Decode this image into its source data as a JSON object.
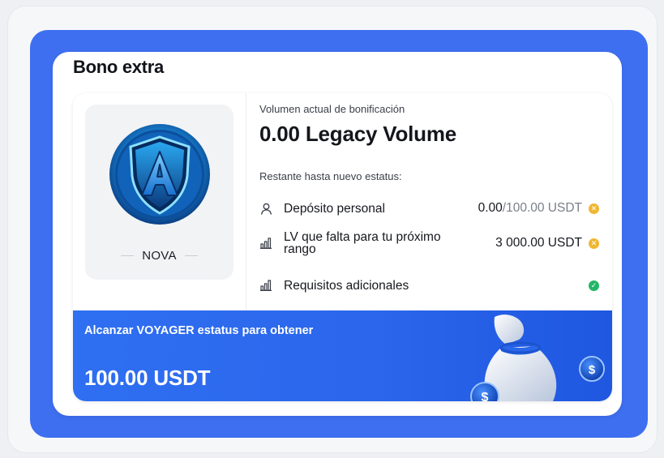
{
  "panel": {
    "title": "Bono extra"
  },
  "badge": {
    "rank_name": "NOVA",
    "icon": "shield-a-icon"
  },
  "volume": {
    "label": "Volumen actual de bonificación",
    "value": "0.00 Legacy Volume"
  },
  "remaining": {
    "label": "Restante hasta nuevo estatus:"
  },
  "requirements": [
    {
      "icon": "user-icon",
      "label": "Depósito personal",
      "current": "0.00",
      "separator": " / ",
      "target": "100.00 USDT",
      "status": "pending"
    },
    {
      "icon": "bar-chart-icon",
      "label": "LV que falta para tu próximo rango",
      "current": "3 000.00 USDT",
      "status": "pending"
    },
    {
      "icon": "bar-chart-icon",
      "label": "Requisitos adicionales",
      "status": "done"
    }
  ],
  "promo": {
    "text": "Alcanzar VOYAGER estatus para obtener",
    "amount": "100.00 USDT"
  },
  "colors": {
    "frame_blue": "#3e6ff0",
    "promo_blue": "#2f6ff1",
    "pending": "#f0b632",
    "done": "#22b566"
  }
}
